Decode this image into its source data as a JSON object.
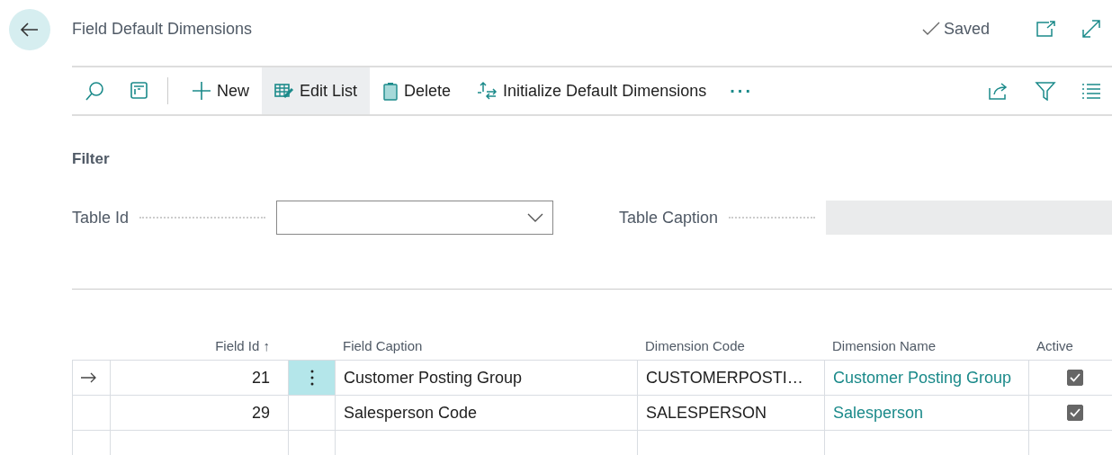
{
  "page": {
    "title": "Field Default Dimensions",
    "status": "Saved"
  },
  "toolbar": {
    "actions": [
      {
        "kind": "new",
        "label": "New",
        "selected": false
      },
      {
        "kind": "edit",
        "label": "Edit List",
        "selected": true
      },
      {
        "kind": "delete",
        "label": "Delete",
        "selected": false
      },
      {
        "kind": "init",
        "label": "Initialize Default Dimensions",
        "selected": false
      }
    ],
    "more": "···"
  },
  "filter": {
    "heading": "Filter",
    "fields": [
      {
        "kind": "dropdown",
        "label": "Table Id",
        "disabled": false
      },
      {
        "kind": "text",
        "label": "Table Caption",
        "disabled": true
      }
    ]
  },
  "table": {
    "columns": [
      "Field Id",
      "Field Caption",
      "Dimension Code",
      "Dimension Name",
      "Active"
    ],
    "sort_mark": "↑",
    "rows": [
      {
        "selected": true,
        "field_id": "21",
        "field_caption": "Customer Posting Group",
        "dimension_code": "CUSTOMERPOSTI…",
        "dimension_name": "Customer Posting Group",
        "active": true
      },
      {
        "selected": false,
        "field_id": "29",
        "field_caption": "Salesperson Code",
        "dimension_code": "SALESPERSON",
        "dimension_name": "Salesperson",
        "active": true
      }
    ]
  }
}
